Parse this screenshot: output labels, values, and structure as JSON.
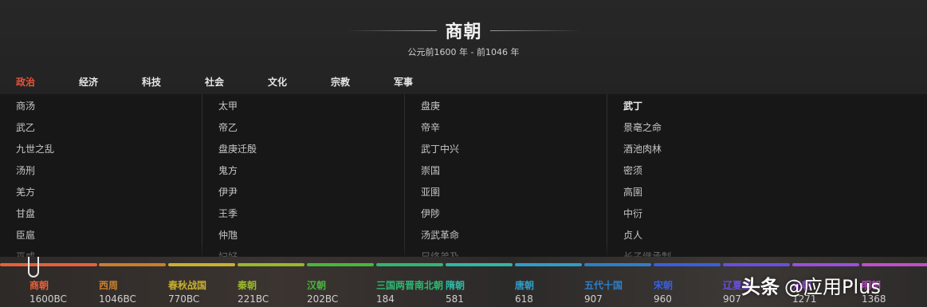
{
  "header": {
    "title": "商朝",
    "subtitle": "公元前1600 年 - 前1046 年"
  },
  "tabs": [
    "政治",
    "经济",
    "科技",
    "社会",
    "文化",
    "宗教",
    "军事"
  ],
  "active_tab": "政治",
  "columns": [
    [
      "商汤",
      "武乙",
      "九世之乱",
      "汤刑",
      "羌方",
      "甘盘",
      "臣扈",
      "巫咸"
    ],
    [
      "太甲",
      "帝乙",
      "盘庚迁殷",
      "鬼方",
      "伊尹",
      "王季",
      "仲虺",
      "妇好"
    ],
    [
      "盘庚",
      "帝辛",
      "武丁中兴",
      "崇国",
      "亚圉",
      "伊陟",
      "汤武革命",
      "兄终弟及"
    ],
    [
      "武丁",
      "景亳之命",
      "酒池肉林",
      "密须",
      "高圉",
      "中衍",
      "贞人",
      "长子继承制"
    ]
  ],
  "timeline": [
    {
      "name": "商朝",
      "year": "1600BC",
      "color": "#e8603a"
    },
    {
      "name": "西周",
      "year": "1046BC",
      "color": "#c97f2e"
    },
    {
      "name": "春秋战国",
      "year": "770BC",
      "color": "#c9b12e"
    },
    {
      "name": "秦朝",
      "year": "221BC",
      "color": "#9ab82a"
    },
    {
      "name": "汉朝",
      "year": "202BC",
      "color": "#47b83a"
    },
    {
      "name": "三国两晋南北朝",
      "year": "184",
      "color": "#2eb872"
    },
    {
      "name": "隋朝",
      "year": "581",
      "color": "#2eb8a5"
    },
    {
      "name": "唐朝",
      "year": "618",
      "color": "#2e9ec9"
    },
    {
      "name": "五代十国",
      "year": "907",
      "color": "#2e7ec9"
    },
    {
      "name": "宋朝",
      "year": "960",
      "color": "#3a5ee0"
    },
    {
      "name": "辽夏金",
      "year": "907",
      "color": "#6a4ee0"
    },
    {
      "name": "元朝",
      "year": "1271",
      "color": "#9a4ee0"
    },
    {
      "name": "明朝",
      "year": "1368",
      "color": "#c04ec9"
    }
  ],
  "watermark": {
    "logo": "头条",
    "text": "@应用Plus"
  }
}
